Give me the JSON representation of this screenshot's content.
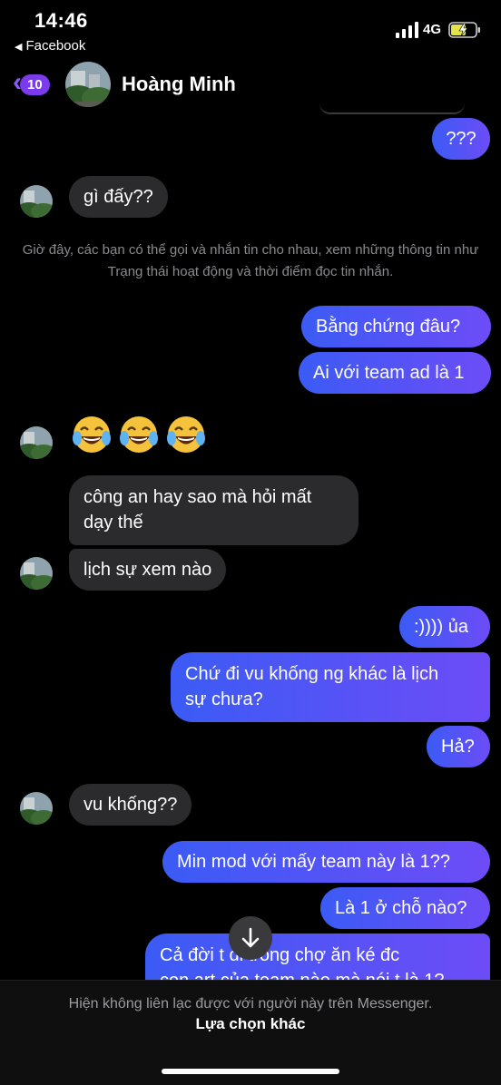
{
  "status_bar": {
    "time": "14:46",
    "back_app": "Facebook",
    "network": "4G"
  },
  "header": {
    "back_count": "10",
    "contact_name": "Hoàng Minh"
  },
  "messages": [
    {
      "from": "me",
      "text": "???"
    },
    {
      "from": "them",
      "text": "gì đấy??"
    },
    {
      "from": "system",
      "text": "Giờ đây, các bạn có thể gọi và nhắn tin cho nhau, xem những thông tin như Trạng thái hoạt động và thời điểm đọc tin nhắn."
    },
    {
      "from": "me",
      "text": "Bằng chứng đâu?"
    },
    {
      "from": "me",
      "text": "Ai với team ad là 1"
    },
    {
      "from": "them",
      "text": "😂😂😂"
    },
    {
      "from": "them",
      "text_lines": [
        "công an hay sao mà hỏi mất",
        "dạy thế"
      ]
    },
    {
      "from": "them",
      "text": "lịch sự xem nào"
    },
    {
      "from": "me",
      "text": ":)))) ủa"
    },
    {
      "from": "me",
      "text_lines": [
        "Chứ đi vu khống ng khác là lịch",
        "sự chưa?"
      ]
    },
    {
      "from": "me",
      "text": "Hả?"
    },
    {
      "from": "them",
      "text": "vu khống??"
    },
    {
      "from": "me",
      "text": "Min mod với mấy team này là 1??"
    },
    {
      "from": "me",
      "text": "Là 1 ở chỗ nào?"
    },
    {
      "from": "me",
      "text_lines": [
        "Cả đời t đi trong chợ ăn ké đc",
        "con art của team nào mà nói t là 1?"
      ]
    }
  ],
  "footer": {
    "notice": "Hiện không liên lạc được với người này trên Messenger.",
    "other_option": "Lựa chọn khác"
  },
  "colors": {
    "accent": "#7c3aed",
    "outgoing_start": "#3b5bf5",
    "outgoing_end": "#6d4cf6",
    "incoming": "#2b2b2d"
  }
}
